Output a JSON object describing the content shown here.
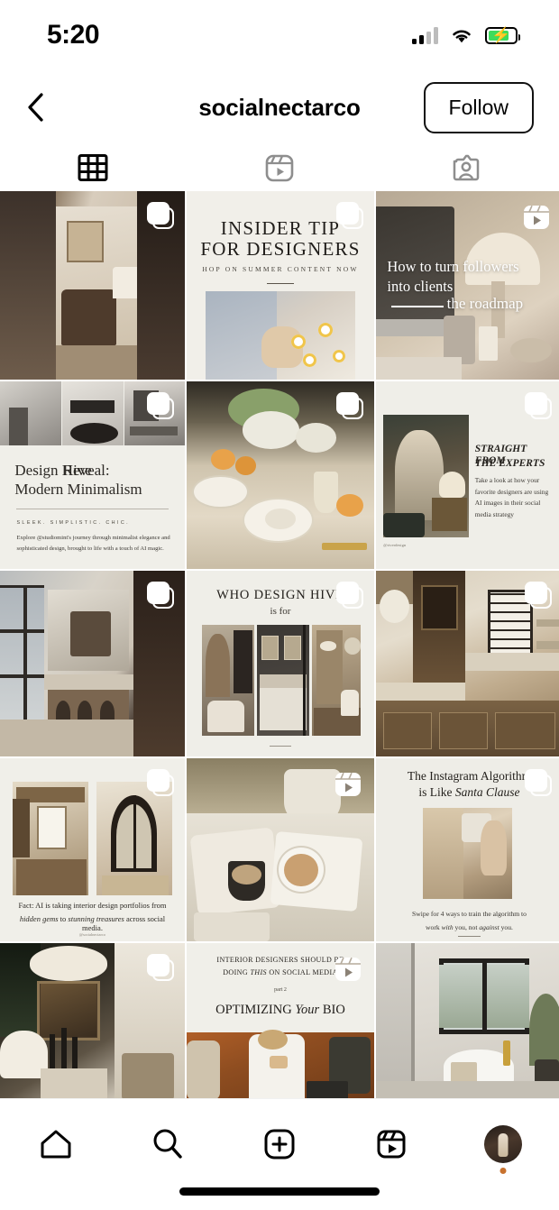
{
  "status_bar": {
    "time": "5:20",
    "signal_icon": "cellular-signal-icon",
    "signal_bars_total": 4,
    "signal_bars_active": 2,
    "wifi_icon": "wifi-icon",
    "battery_icon": "battery-charging-icon",
    "battery_level_percent": 78,
    "battery_color": "#3ddc5c"
  },
  "header": {
    "back_icon": "chevron-left-icon",
    "username": "socialnectarco",
    "follow_label": "Follow"
  },
  "tabs": [
    {
      "id": "grid",
      "icon": "grid-icon",
      "active": true,
      "color": "#000000"
    },
    {
      "id": "reels",
      "icon": "reels-icon",
      "active": false,
      "color": "#8e8e8e"
    },
    {
      "id": "tagged",
      "icon": "tagged-person-icon",
      "active": false,
      "color": "#8e8e8e"
    }
  ],
  "grid": {
    "columns": 3,
    "posts": [
      {
        "id": "post-1",
        "row": 1,
        "col": 1,
        "type": "carousel",
        "badge_icon": "carousel-icon",
        "description": "Interior photo of a home office with desk, chair, lamp and artwork seen through a doorway",
        "caption": ""
      },
      {
        "id": "post-2",
        "row": 1,
        "col": 2,
        "type": "carousel",
        "badge_icon": "carousel-icon",
        "title_line1": "INSIDER TIP",
        "title_line2": "FOR DESIGNERS",
        "subtitle": "HOP ON SUMMER CONTENT NOW",
        "description": "Hand resting on a bouquet of daisies, cream background"
      },
      {
        "id": "post-3",
        "row": 1,
        "col": 3,
        "type": "reel",
        "badge_icon": "reels-icon",
        "title_line1": "How to turn followers",
        "title_line2": "into clients",
        "title_line3": "the roadmap",
        "description": "Desk with iMac computer, table lamp, candle and pen cup"
      },
      {
        "id": "post-4",
        "row": 2,
        "col": 1,
        "type": "carousel",
        "badge_icon": "carousel-icon",
        "title_italic": "Design Hive",
        "title_rest": " Reveal:",
        "title_line2": "Modern Minimalism",
        "eyebrow": "SLEEK.  SIMPLISTIC.  CHIC.",
        "body": "Explore @studiomint's journey through minimalist elegance and sophisticated design, brought to life with a touch of AI magic.",
        "description": "Three minimalist monochrome interior photos across the top"
      },
      {
        "id": "post-5",
        "row": 2,
        "col": 2,
        "type": "carousel",
        "badge_icon": "carousel-icon",
        "description": "Styled dining table with white plates, oranges, baby's breath florals and glassware"
      },
      {
        "id": "post-6",
        "row": 2,
        "col": 3,
        "type": "carousel",
        "badge_icon": "carousel-icon",
        "title_line1": "STRAIGHT FROM",
        "title_line2": "THE EXPERTS",
        "body": "Take a look at how your favorite designers are using AI images in their social media strategy",
        "credit": "@riverdesign",
        "description": "Dark green traditional hallway with arched doorway, lamp and dresser"
      },
      {
        "id": "post-7",
        "row": 3,
        "col": 1,
        "type": "carousel",
        "badge_icon": "carousel-icon",
        "description": "Modern kitchen with floor to ceiling windows, marble island and bar stools"
      },
      {
        "id": "post-8",
        "row": 3,
        "col": 2,
        "type": "carousel",
        "badge_icon": "carousel-icon",
        "title_line1": "WHO DESIGN HIVE",
        "title_line2": "is for",
        "description": "Triptych of three interior rooms: armchair with shelving, four-poster bed, built-in shelves"
      },
      {
        "id": "post-9",
        "row": 3,
        "col": 3,
        "type": "carousel",
        "badge_icon": "carousel-icon",
        "description": "Warm wood kitchen with tall cabinetry, arched window and marble counters"
      },
      {
        "id": "post-10",
        "row": 4,
        "col": 1,
        "type": "carousel",
        "badge_icon": "carousel-icon",
        "caption_line1": "Fact: AI is taking interior design portfolios from",
        "caption_line2_a": "hidden gems",
        "caption_line2_b": " to ",
        "caption_line2_c": "stunning treasures",
        "caption_line2_d": " across social media.",
        "credit": "@socialnectarco",
        "description": "Two side-by-side photos: rustic kitchen and arched black French doors"
      },
      {
        "id": "post-11",
        "row": 4,
        "col": 2,
        "type": "reel",
        "badge_icon": "reels-icon",
        "description": "Flat lay of coffee cups, magazines and a knit blanket on a bed"
      },
      {
        "id": "post-12",
        "row": 4,
        "col": 3,
        "type": "carousel",
        "badge_icon": "carousel-icon",
        "title_line1": "The Instagram Algorithm",
        "title_line2_a": "is Like ",
        "title_line2_b": "Santa Clause",
        "caption_line1_a": "Swipe for 4 ways to train the algorithm to",
        "caption_line2_a": "work ",
        "caption_line2_b": "with",
        "caption_line2_c": " you, not ",
        "caption_line2_d": "against",
        "caption_line2_e": " you.",
        "description": "Blonde woman holding a glass, backlit warm photo"
      },
      {
        "id": "post-13",
        "row": 5,
        "col": 1,
        "type": "carousel",
        "badge_icon": "carousel-icon",
        "description": "Moody interior with scalloped lampshade, framed art, candles and greenery"
      },
      {
        "id": "post-14",
        "row": 5,
        "col": 2,
        "type": "reel",
        "badge_icon": "reels-icon",
        "title_line1_a": "INTERIOR DESIGNERS SHOULD BE",
        "title_line2_a": "DOING ",
        "title_line2_b": "THIS",
        "title_line2_c": " ON SOCIAL MEDIA",
        "part_label": "part 2",
        "headline_a": "OPTIMIZING ",
        "headline_b": "Your",
        "headline_c": " BIO",
        "description": "Woman in white on a rust-colored tufted sofa using a phone and laptop"
      },
      {
        "id": "post-15",
        "row": 5,
        "col": 3,
        "type": "photo",
        "badge_icon": "",
        "description": "Bright bathroom with black-framed window, freestanding tub and potted tree"
      }
    ]
  },
  "bottom_nav": {
    "items": [
      {
        "id": "home",
        "icon": "home-icon"
      },
      {
        "id": "search",
        "icon": "search-icon"
      },
      {
        "id": "create",
        "icon": "plus-square-icon"
      },
      {
        "id": "reels",
        "icon": "reels-icon"
      },
      {
        "id": "profile",
        "icon": "profile-avatar-icon",
        "has_dot": true,
        "dot_color": "#c8722e"
      }
    ],
    "home_indicator": "home-indicator"
  }
}
